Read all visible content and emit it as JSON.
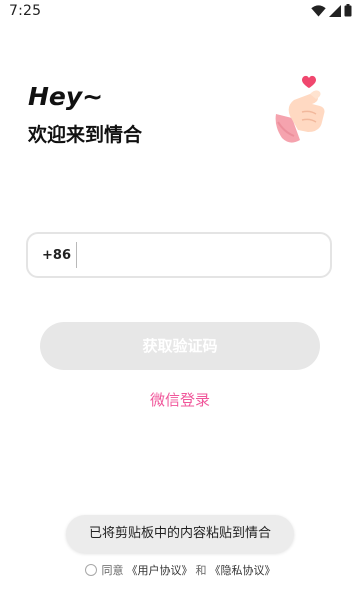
{
  "status_bar": {
    "time": "7:25"
  },
  "header": {
    "greeting": "Hey~",
    "welcome": "欢迎来到情合"
  },
  "phone": {
    "country_code": "+86",
    "value": ""
  },
  "get_code_button": {
    "label": "获取验证码",
    "bg_color": "#e7e7e7"
  },
  "wechat_login": {
    "label": "微信登录",
    "color": "#f0569a"
  },
  "toast": {
    "text": "已将剪贴板中的内容粘贴到情合"
  },
  "agreement": {
    "prefix": "同意",
    "user_agreement": "《用户协议》",
    "and": "和",
    "privacy_agreement": "《隐私协议》"
  },
  "icons": {
    "wifi": "wifi-icon",
    "signal": "signal-icon",
    "battery": "battery-icon",
    "hand": "heart-hand-icon"
  }
}
